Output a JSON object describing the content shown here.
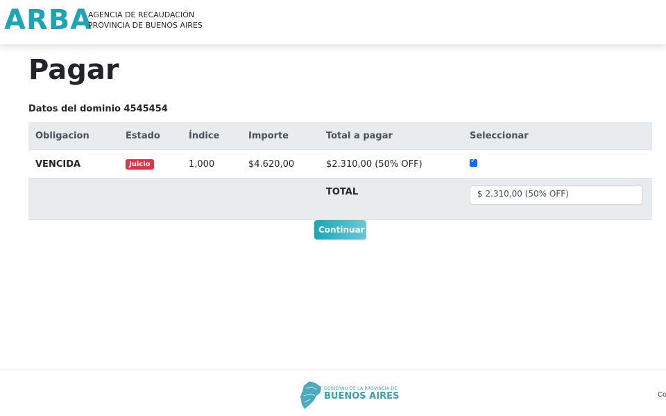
{
  "header": {
    "brand": "ARBA",
    "agency_line1": "AGENCIA DE RECAUDACIÓN",
    "agency_line2": "PROVINCIA DE BUENOS AIRES"
  },
  "page": {
    "title": "Pagar",
    "domain_label": "Datos del dominio 4545454"
  },
  "table": {
    "columns": [
      "Obligacion",
      "Estado",
      "Índice",
      "Importe",
      "Total a pagar",
      "Seleccionar"
    ],
    "rows": [
      {
        "obligacion": "VENCIDA",
        "estado": "Juicio",
        "indice": "1,000",
        "importe": "$4.620,00",
        "total": "$2.310,00 (50% OFF)",
        "selected": true
      }
    ],
    "total_label": "TOTAL",
    "total_value": "$ 2.310,00 (50% OFF)"
  },
  "actions": {
    "continue_label": "Continuar"
  },
  "footer": {
    "gov_small": "GOBIERNO DE LA PROVINCIA DE",
    "gov_big": "BUENOS AIRES",
    "right_text": "Co"
  },
  "colors": {
    "brand": "#1ea4b4",
    "badge": "#dc3545",
    "checkbox": "#0d6efd",
    "button_start": "#19a7b8",
    "button_end": "#6bc7d3"
  }
}
